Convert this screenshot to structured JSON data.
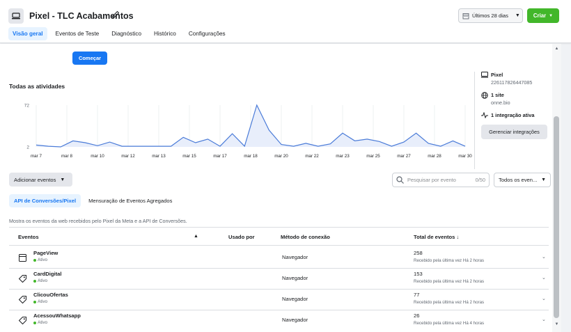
{
  "header": {
    "title": "Pixel - TLC Acabamentos",
    "date_range": "Últimos 28 dias",
    "create_label": "Criar",
    "tabs": [
      {
        "label": "Visão geral",
        "active": true
      },
      {
        "label": "Eventos de Teste",
        "active": false
      },
      {
        "label": "Diagnóstico",
        "active": false
      },
      {
        "label": "Histórico",
        "active": false
      },
      {
        "label": "Configurações",
        "active": false
      }
    ]
  },
  "start_button": "Começar",
  "activity": {
    "title": "Todas as atividades"
  },
  "chart_data": {
    "type": "area",
    "title": "Todas as atividades",
    "x_labels": [
      "mar 7",
      "mar 8",
      "mar 10",
      "mar 12",
      "mar 13",
      "mar 15",
      "mar 17",
      "mar 18",
      "mar 20",
      "mar 22",
      "mar 23",
      "mar 25",
      "mar 27",
      "mar 28",
      "mar 30"
    ],
    "y_ticks": [
      2,
      72
    ],
    "ylim": [
      2,
      72
    ],
    "series": [
      {
        "values": [
          5,
          3,
          2,
          12,
          9,
          4,
          10,
          3,
          3,
          3,
          3,
          3,
          18,
          9,
          15,
          3,
          24,
          3,
          72,
          30,
          6,
          3,
          8,
          3,
          7,
          25,
          12,
          15,
          11,
          3,
          10,
          25,
          8,
          3,
          12,
          3
        ]
      }
    ],
    "color": "#4a7bd8",
    "fill": "#e8eefb"
  },
  "side_panel": {
    "pixel_label": "Pixel",
    "pixel_id": "226117826447085",
    "site_label": "1 site",
    "site_value": "onne.bio",
    "integration_label": "1 integração ativa",
    "manage_button": "Gerenciar integrações"
  },
  "toolbar": {
    "add_events": "Adicionar eventos",
    "search_placeholder": "Pesquisar por evento",
    "search_count": "0/50",
    "all_events": "Todos os even..."
  },
  "sub_tabs": [
    {
      "label": "API de Conversões/Pixel",
      "active": true
    },
    {
      "label": "Mensuração de Eventos Agregados",
      "active": false
    }
  ],
  "description": "Mostra os eventos da web recebidos pelo Pixel da Meta e a API de Conversões.",
  "table": {
    "headers": {
      "events": "Eventos",
      "warning": "▲",
      "used_by": "Usado por",
      "method": "Método de conexão",
      "total": "Total de eventos ↓"
    },
    "rows": [
      {
        "name": "PageView",
        "status": "Ativo",
        "method": "Navegador",
        "total": "258",
        "received": "Recebido pela última vez Há 2 horas",
        "icon": "page-icon"
      },
      {
        "name": "CardDigital",
        "status": "Ativo",
        "method": "Navegador",
        "total": "153",
        "received": "Recebido pela última vez Há 2 horas",
        "icon": "tag-icon"
      },
      {
        "name": "ClicouOfertas",
        "status": "Ativo",
        "method": "Navegador",
        "total": "77",
        "received": "Recebido pela última vez Há 2 horas",
        "icon": "tag-icon"
      },
      {
        "name": "AcessouWhatsapp",
        "status": "Ativo",
        "method": "Navegador",
        "total": "26",
        "received": "Recebido pela última vez Há 4 horas",
        "icon": "tag-icon"
      }
    ]
  },
  "colors": {
    "primary": "#1877f2",
    "create": "#42b72a",
    "active_dot": "#42b72a"
  }
}
